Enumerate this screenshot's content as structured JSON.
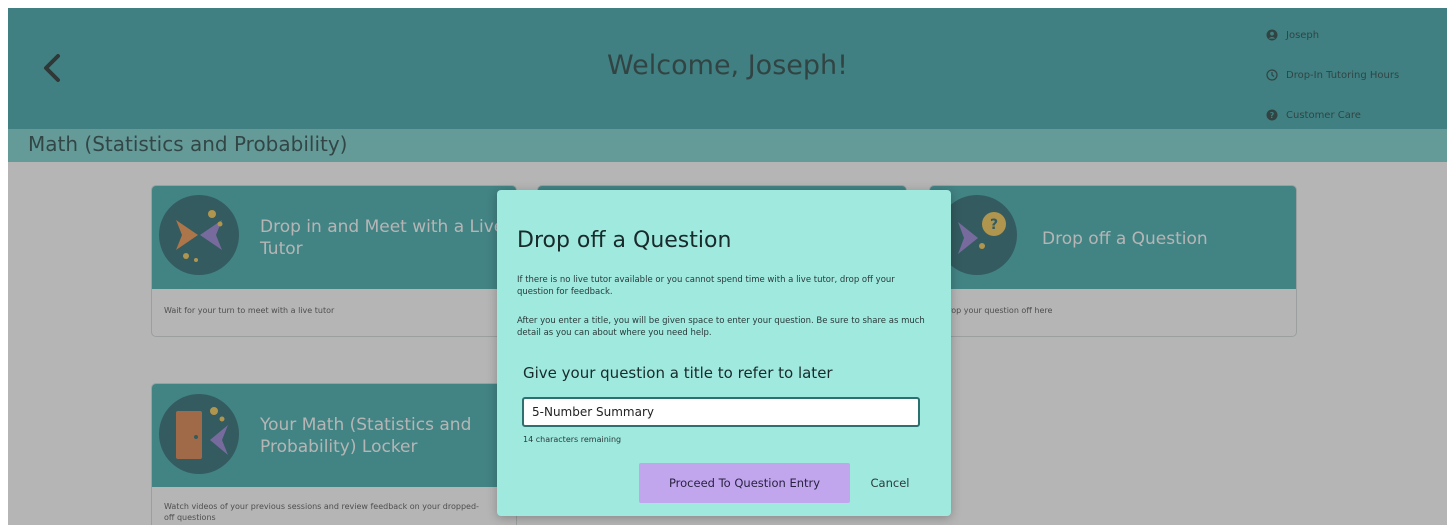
{
  "header": {
    "welcome": "Welcome, Joseph!",
    "links": [
      {
        "label": "Joseph",
        "icon": "user-circle-icon"
      },
      {
        "label": "Drop-In Tutoring Hours",
        "icon": "clock-icon"
      },
      {
        "label": "Customer Care",
        "icon": "help-circle-icon"
      }
    ]
  },
  "subject": "Math (Statistics and Probability)",
  "cards": [
    {
      "title": "Drop in and Meet with a Live Tutor",
      "desc": "Wait for your turn to meet with a live tutor",
      "icon": "live-tutor-icon"
    },
    {
      "title": "Drop off a Question",
      "desc": "Drop your question off here",
      "icon": "question-bubble-icon"
    },
    {
      "title": "Your Math (Statistics and Probability) Locker",
      "desc": "Watch videos of your previous sessions and review feedback on your dropped-off questions",
      "icon": "locker-icon"
    }
  ],
  "dialog": {
    "title": "Drop off a Question",
    "paragraph1": "If there is no live tutor available or you cannot spend time with a live tutor, drop off your question for feedback.",
    "paragraph2": "After you enter a title, you will be given space to enter your question. Be sure to share as much detail as you can about where you need help.",
    "field_label": "Give your question a title to refer to later",
    "field_value": "5-Number Summary",
    "remaining": "14 characters remaining",
    "proceed_label": "Proceed To Question Entry",
    "cancel_label": "Cancel"
  },
  "colors": {
    "header": "#2b9fa2",
    "subject_bar": "#6ccfcc",
    "card_top": "#2fa4a6",
    "dialog_bg": "#a0e9df",
    "proceed_button": "#c1a6ee",
    "overlay": "rgba(90,90,90,0.45)"
  }
}
